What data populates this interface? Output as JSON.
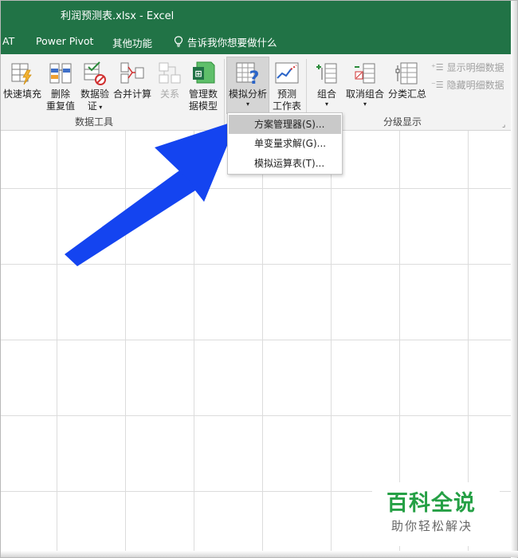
{
  "window": {
    "title": "利润预测表.xlsx  -  Excel"
  },
  "tabs": {
    "partial": "AT",
    "power_pivot": "Power Pivot",
    "other": "其他功能",
    "tell_me": "告诉我你想要做什么"
  },
  "ribbon": {
    "flash_fill": "快速填充",
    "remove_dup_1": "删除",
    "remove_dup_2": "重复值",
    "data_valid_1": "数据验",
    "data_valid_2": "证",
    "consolidate": "合并计算",
    "relations": "关系",
    "manage_model_1": "管理数",
    "manage_model_2": "据模型",
    "whatif": "模拟分析",
    "forecast_1": "预测",
    "forecast_2": "工作表",
    "group": "组合",
    "ungroup": "取消组合",
    "subtotal": "分类汇总",
    "show_detail": "显示明细数据",
    "hide_detail": "隐藏明细数据",
    "group_data_tools": "数据工具",
    "group_outline": "分级显示"
  },
  "menu": {
    "items": [
      "方案管理器(S)...",
      "单变量求解(G)...",
      "模拟运算表(T)..."
    ]
  },
  "watermark": {
    "title": "百科全说",
    "subtitle": "助你轻松解决"
  },
  "colors": {
    "excel_green": "#217346",
    "arrow_blue": "#1444f0",
    "watermark_green": "#25a045"
  }
}
